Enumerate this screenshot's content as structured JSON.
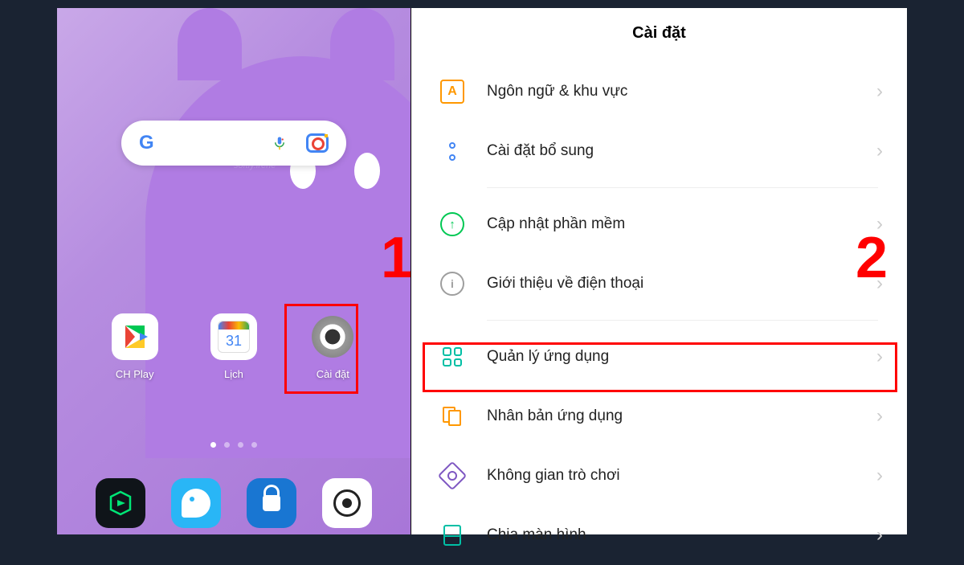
{
  "annotations": {
    "step1": "1",
    "step2": "2"
  },
  "home": {
    "search_watermark": "softly.irene",
    "calendar_day": "31",
    "apps": [
      {
        "label": "CH Play"
      },
      {
        "label": "Lịch"
      },
      {
        "label": "Cài đặt"
      }
    ]
  },
  "settings": {
    "title": "Cài đặt",
    "items": [
      {
        "label": "Ngôn ngữ & khu vực"
      },
      {
        "label": "Cài đặt bổ sung"
      },
      {
        "label": "Cập nhật phần mềm"
      },
      {
        "label": "Giới thiệu về điện thoại"
      },
      {
        "label": "Quản lý ứng dụng"
      },
      {
        "label": "Nhân bản ứng dụng"
      },
      {
        "label": "Không gian trò chơi"
      },
      {
        "label": "Chia màn hình"
      }
    ]
  }
}
